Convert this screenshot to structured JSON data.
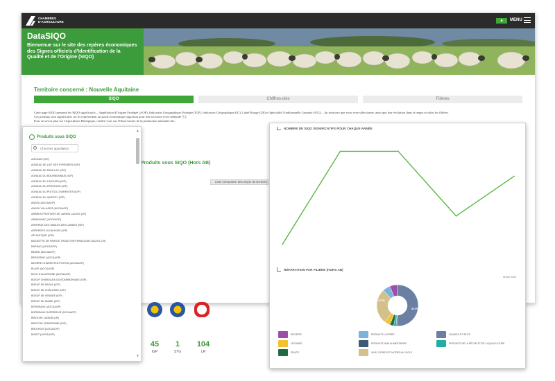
{
  "header": {
    "logo_text": "CHAMBRES D'AGRICULTURE",
    "menu_label": "MENU",
    "badge_label": "■"
  },
  "hero": {
    "title": "DataSIQO",
    "subtitle": "Bienvenue sur le site des repères économiques des Signes officiels d'Identification de la Qualité et de l'Origine (SIQO)"
  },
  "territoire": "Territoire concerné : Nouvelle Aquitaine",
  "tabs": [
    {
      "label": "SIQO",
      "active": true
    },
    {
      "label": "Chiffres-clés",
      "active": false
    },
    {
      "label": "Filières",
      "active": false
    }
  ],
  "intro": {
    "line1": "Cette page SIQO présente les SIQO significatifs – Appellation d'Origine Protégée (AOP), Indication Géographique Protégée (IGP), Indication Géographique (IG), Label Rouge (LR) et Spécialité Traditionnelle Garantie (STG) – du territoire que vous avez sélectionné, ainsi que leur évolution dans le temps et selon les filières.",
    "line2": "Ces produits sont significatifs car ils représentent un poids économique important pour leur territoire (voir méthode ⓘ).",
    "line3": "Pour en savoir plus sur l'Agriculture Biologique, rendez-vous sur l'Observatoire de la production nationale bio."
  },
  "hors_ab_title": "Produits sous SIQO (Hors AB)",
  "liste_button": "Liste exhaustive des SIQO du territoire",
  "counts": [
    {
      "value": "45",
      "label": "IGP"
    },
    {
      "value": "1",
      "label": "STG"
    },
    {
      "value": "104",
      "label": "LR"
    }
  ],
  "list_panel": {
    "title": "Produits sous SIQO",
    "search_placeholder": "Chercher appellation",
    "items": [
      "AGENAIS (IGP)",
      "AGNEAU DE LAIT DES PYRENEES (IGP)",
      "AGNEAU DE PAUILLAC (IGP)",
      "AGNEAU DU BOURBONNAIS (IGP)",
      "AGNEAU DU LIMOUSIN (IGP)",
      "AGNEAU DU PERIGORD (IGP)",
      "AGNEAU DU POITOU-CHARENTES (IGP)",
      "AGNEAU DU QUERCY (IGP)",
      "ANJOU (AOC&AOP)",
      "ANJOU VILLAGES (AOC&AOP)",
      "ARBRES FRUITIERS DE JARDIN LA23/01 (LR)",
      "ARMAGNAC (AOC&AOP)",
      "ASPERGE DES SABLES DES LANDES (IGP)",
      "ASPERGES DU BLAYAIS (IGP)",
      "ATLANTIQUE (IGP)",
      "BAGUETTE DE PAIN DE TRADITION FRANCAISE LA22/01 (LR)",
      "BARSAC (AOC&AOP)",
      "BEARN (AOC&AOP)",
      "BERGERAC (AOC&AOP)",
      "BEURRE CHARENTES-POITOU (AOC&AOP)",
      "BLAYE (AOC&AOP)",
      "BLEU D'AUVERGNE (AOC&AOP)",
      "BOEUF CHAROLAIS DU BOURBONNAIS (IGP)",
      "BOEUF DE BAZAS (IGP)",
      "BOEUF DE CHALOSSE (IGP)",
      "BOEUF DE VENDEE (IGP)",
      "BOEUF DU MAINE (IGP)",
      "BORDEAUX (AOC&AOP)",
      "BORDEAUX SUPERIEUR (AOC&AOP)",
      "BRIOCHE LA05/08 (LR)",
      "BRIOCHE VENDEENNE (IGP)",
      "BRULHOIS (AOC&AOP)",
      "BUZET (AOC&AOP)"
    ]
  },
  "chart_panel": {
    "title": "NOMBRE DE SIQO SIGNIFICATIFS POUR CHAQUE ANNÉE",
    "donut_title": "RÉPARTITION PAR FILIÈRE (HORS AB)",
    "donut_date": "Année 2022"
  },
  "chart_data": [
    {
      "type": "line",
      "title": "NOMBRE DE SIQO SIGNIFICATIFS POUR CHAQUE ANNÉE",
      "series": [
        {
          "values": [
            108,
            190,
            190,
            133,
            168
          ],
          "color": "#5cb543"
        }
      ],
      "ylim": [
        100,
        200
      ],
      "grid": false
    },
    {
      "type": "pie",
      "title": "RÉPARTITION PAR FILIÈRE (HORS AB)",
      "slices": [
        {
          "label": "VIANDES ET ŒUFS",
          "value": 50.0,
          "color": "#6b7fa3"
        },
        {
          "label": "PRODUITS NON ALIMENTAIRES",
          "value": 1.0,
          "color": "#3c5b79"
        },
        {
          "label": "PRODUITS DE LA PÊCHE ET DE L'AQUACULTURE",
          "value": 2.0,
          "color": "#1fb0a3"
        },
        {
          "label": "FRUITS",
          "value": 3.0,
          "color": "#1e6b46"
        },
        {
          "label": "LÉGUMES",
          "value": 4.5,
          "color": "#f2c230"
        },
        {
          "label": "VINS, CIDRES ET AUTRES ALCOOLS",
          "value": 27.5,
          "color": "#d4c08a"
        },
        {
          "label": "PRODUITS LAITIERS",
          "value": 6.0,
          "color": "#7bb3dd"
        },
        {
          "label": "ÉPICERIE",
          "value": 6.0,
          "color": "#9b4fa8"
        }
      ],
      "data_labels": [
        "50.0%",
        "27.5%"
      ]
    }
  ]
}
